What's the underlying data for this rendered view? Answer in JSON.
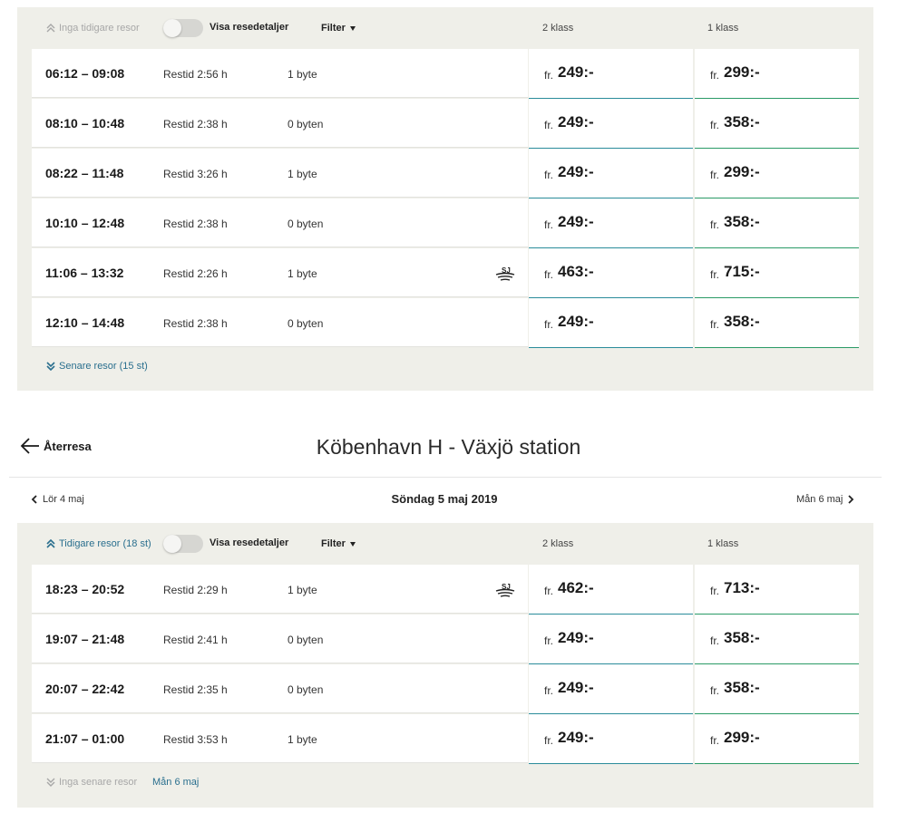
{
  "outbound": {
    "earlier": "Inga tidigare resor",
    "toggle_label": "Visa resedetaljer",
    "filter": "Filter",
    "class2": "2 klass",
    "class1": "1 klass",
    "fr": "fr.",
    "rows": [
      {
        "time": "06:12 – 09:08",
        "dur": "Restid 2:56 h",
        "changes": "1 byte",
        "sj": false,
        "p2": "249:-",
        "p1": "299:-"
      },
      {
        "time": "08:10 – 10:48",
        "dur": "Restid 2:38 h",
        "changes": "0 byten",
        "sj": false,
        "p2": "249:-",
        "p1": "358:-"
      },
      {
        "time": "08:22 – 11:48",
        "dur": "Restid 3:26 h",
        "changes": "1 byte",
        "sj": false,
        "p2": "249:-",
        "p1": "299:-"
      },
      {
        "time": "10:10 – 12:48",
        "dur": "Restid 2:38 h",
        "changes": "0 byten",
        "sj": false,
        "p2": "249:-",
        "p1": "358:-"
      },
      {
        "time": "11:06 – 13:32",
        "dur": "Restid 2:26 h",
        "changes": "1 byte",
        "sj": true,
        "p2": "463:-",
        "p1": "715:-"
      },
      {
        "time": "12:10 – 14:48",
        "dur": "Restid 2:38 h",
        "changes": "0 byten",
        "sj": false,
        "p2": "249:-",
        "p1": "358:-"
      }
    ],
    "later": "Senare resor (15 st)"
  },
  "return": {
    "back_label": "Återresa",
    "route": "Köbenhavn H - Växjö station",
    "prev_date": "Lör 4 maj",
    "current_date": "Söndag 5 maj 2019",
    "next_date": "Mån 6 maj",
    "earlier": "Tidigare resor (18 st)",
    "toggle_label": "Visa resedetaljer",
    "filter": "Filter",
    "class2": "2 klass",
    "class1": "1 klass",
    "fr": "fr.",
    "rows": [
      {
        "time": "18:23 – 20:52",
        "dur": "Restid 2:29 h",
        "changes": "1 byte",
        "sj": true,
        "p2": "462:-",
        "p1": "713:-"
      },
      {
        "time": "19:07 – 21:48",
        "dur": "Restid 2:41 h",
        "changes": "0 byten",
        "sj": false,
        "p2": "249:-",
        "p1": "358:-"
      },
      {
        "time": "20:07 – 22:42",
        "dur": "Restid 2:35 h",
        "changes": "0 byten",
        "sj": false,
        "p2": "249:-",
        "p1": "358:-"
      },
      {
        "time": "21:07 – 01:00",
        "dur": "Restid 3:53 h",
        "changes": "1 byte",
        "sj": false,
        "p2": "249:-",
        "p1": "299:-"
      }
    ],
    "later": "Inga senare resor",
    "later_next": "Mån 6 maj"
  },
  "icons": {
    "chevron_up_double": "double-chevron-up-icon",
    "chevron_down_double": "double-chevron-down-icon",
    "arrow_left": "arrow-left-icon",
    "chevron_left": "chevron-left-icon",
    "chevron_right": "chevron-right-icon",
    "operator": "sj-logo-icon"
  },
  "colors": {
    "panel_bg": "#efefe9",
    "link": "#2a6f8e",
    "class2_underline": "#2a8c9a",
    "class1_underline": "#2a9a66"
  }
}
